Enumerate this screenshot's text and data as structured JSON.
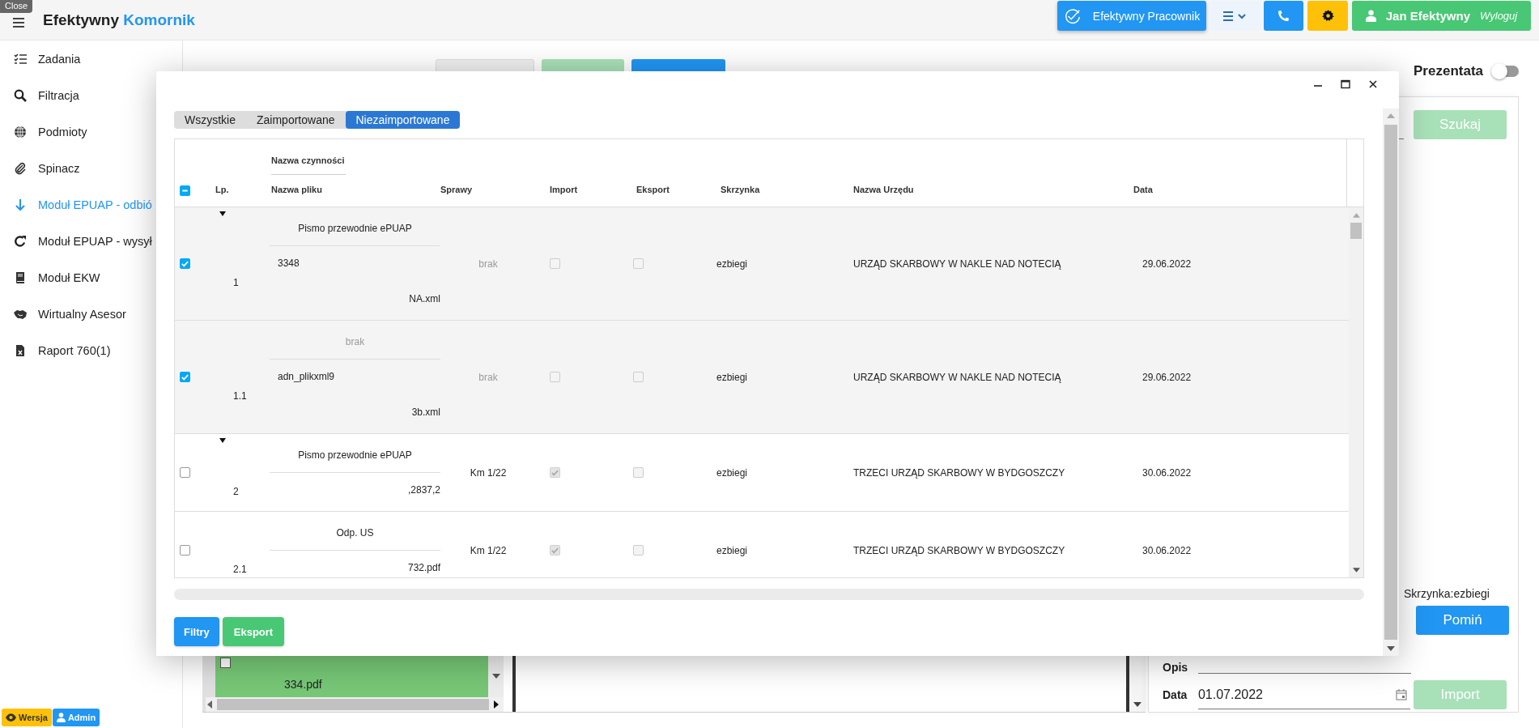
{
  "header": {
    "close_tooltip": "Close",
    "brand": {
      "name": "Efektywny",
      "accent": "Komornik"
    },
    "buttons": [
      {
        "kind": "app",
        "label": "Efektywny Pracownik"
      },
      {
        "kind": "menu"
      },
      {
        "kind": "phone"
      },
      {
        "kind": "settings"
      },
      {
        "kind": "user",
        "label": "Jan Efektywny",
        "action": "Wyloguj"
      }
    ]
  },
  "sidebar": {
    "items": [
      {
        "kind": "tasks",
        "label": "Zadania",
        "selected": false
      },
      {
        "kind": "search",
        "label": "Filtracja",
        "selected": false
      },
      {
        "kind": "globe",
        "label": "Podmioty",
        "selected": false
      },
      {
        "kind": "clip",
        "label": "Spinacz",
        "selected": false
      },
      {
        "kind": "download",
        "label": "Moduł EPUAP - odbió",
        "selected": true
      },
      {
        "kind": "refresh",
        "label": "Moduł EPUAP - wysył",
        "selected": false
      },
      {
        "kind": "book",
        "label": "Moduł EKW",
        "selected": false
      },
      {
        "kind": "handshake",
        "label": "Wirtualny Asesor",
        "selected": false
      },
      {
        "kind": "sheet",
        "label": "Raport 760(1)",
        "selected": false
      }
    ],
    "badges": [
      {
        "kind": "version",
        "label": "Wersja"
      },
      {
        "kind": "user",
        "label": "Admin"
      }
    ]
  },
  "page": {
    "toolbar_buttons": [
      {
        "kind": "neutral"
      },
      {
        "kind": "success"
      },
      {
        "kind": "primary"
      }
    ],
    "presenter": {
      "label": "Prezentata",
      "on": false
    },
    "search_button": {
      "label": "Szukaj",
      "disabled": true
    },
    "file_list": {
      "rows": [
        {
          "file": "334.pdf",
          "selected": true,
          "checked": false
        }
      ]
    },
    "mailbox_info": "Skrzynka:ezbiegi",
    "skip_button": {
      "label": "Pomiń"
    },
    "description": {
      "label": "Opis"
    },
    "date": {
      "label": "Data",
      "value": "01.07.2022"
    },
    "import_button": {
      "label": "Import",
      "disabled": true
    }
  },
  "dialog": {
    "tabs": [
      {
        "label": "Wszystkie",
        "selected": false
      },
      {
        "label": "Zaimportowane",
        "selected": false
      },
      {
        "label": "Niezaimportowane",
        "selected": true
      }
    ],
    "table": {
      "select_all": {
        "indeterminate": true
      },
      "columns": {
        "lp": "Lp.",
        "action": "Nazwa czynności",
        "file": "Nazwa pliku",
        "cases": "Sprawy",
        "import": "Import",
        "export": "Eksport",
        "mailbox": "Skrzynka",
        "office": "Nazwa Urzędu",
        "date": "Data"
      },
      "rows": [
        {
          "lp": "1",
          "expanded": true,
          "selected": true,
          "action": "Pismo przewodnie ePUAP",
          "action_missing": false,
          "file_lines": [
            "3348",
            "NA.xml"
          ],
          "cases": "brak",
          "cases_missing": true,
          "import": false,
          "export": false,
          "mailbox": "ezbiegi",
          "office": "URZĄD SKARBOWY W NAKLE NAD NOTECIĄ",
          "date": "29.06.2022"
        },
        {
          "lp": "1.1",
          "selected": true,
          "action": "brak",
          "action_missing": true,
          "file_lines": [
            "adn_plikxml9",
            "3b.xml"
          ],
          "cases": "brak",
          "cases_missing": true,
          "import": false,
          "export": false,
          "mailbox": "ezbiegi",
          "office": "URZĄD SKARBOWY W NAKLE NAD NOTECIĄ",
          "date": "29.06.2022"
        },
        {
          "lp": "2",
          "expanded": true,
          "selected": false,
          "action": "Pismo przewodnie ePUAP",
          "action_missing": false,
          "file_lines": [
            ",2837,2"
          ],
          "cases": "Km 1/22",
          "cases_missing": false,
          "import": true,
          "export": false,
          "mailbox": "ezbiegi",
          "office": "TRZECI URZĄD SKARBOWY W BYDGOSZCZY",
          "date": "30.06.2022"
        },
        {
          "lp": "2.1",
          "selected": false,
          "action": "Odp. US",
          "action_missing": false,
          "file_lines": [
            "732.pdf"
          ],
          "cases": "Km 1/22",
          "cases_missing": false,
          "import": true,
          "export": false,
          "mailbox": "ezbiegi",
          "office": "TRZECI URZĄD SKARBOWY W BYDGOSZCZY",
          "date": "30.06.2022"
        }
      ]
    },
    "buttons": [
      {
        "kind": "primary",
        "label": "Filtry"
      },
      {
        "kind": "success",
        "label": "Eksport"
      }
    ]
  }
}
